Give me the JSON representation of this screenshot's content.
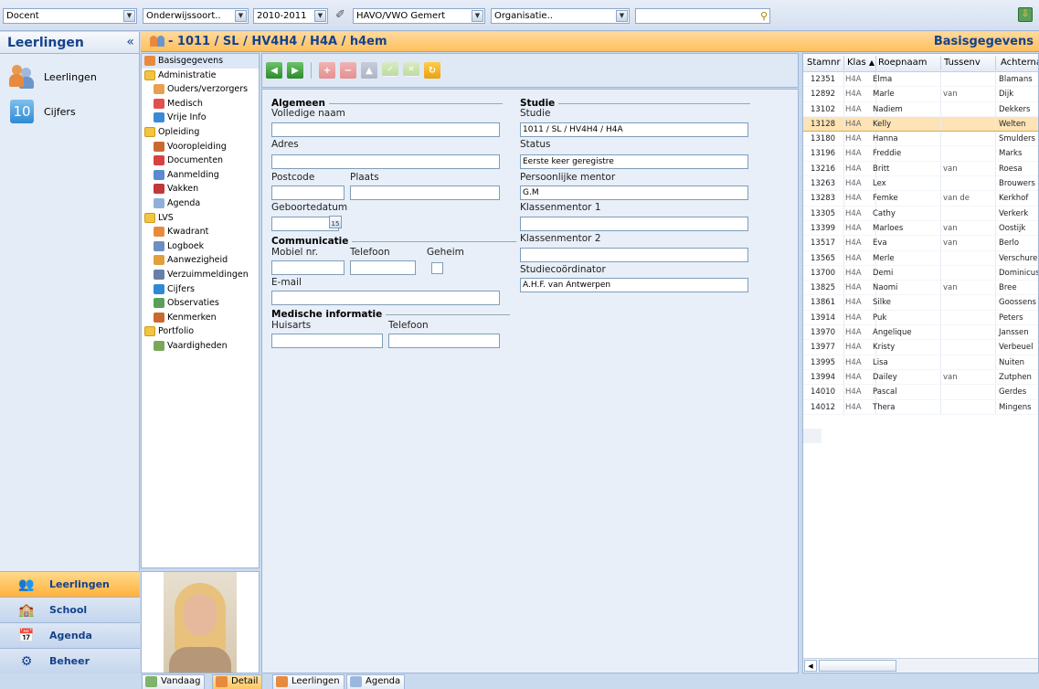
{
  "topbar": {
    "role": "Docent",
    "education_type": "Onderwijssoort..",
    "year": "2010-2011",
    "school": "HAVO/VWO Gemert",
    "organisation": "Organisatie..",
    "search_value": ""
  },
  "sidebar": {
    "title": "Leerlingen",
    "collapse_glyph": "«",
    "items": [
      {
        "label": "Leerlingen",
        "icon": "students-icon"
      },
      {
        "label": "Cijfers",
        "icon": "grades-icon",
        "badge": "10"
      }
    ],
    "sections": [
      {
        "label": "Leerlingen",
        "icon": "students-icon",
        "active": true
      },
      {
        "label": "School",
        "icon": "school-icon"
      },
      {
        "label": "Agenda",
        "icon": "calendar-icon"
      },
      {
        "label": "Beheer",
        "icon": "gear-icon"
      }
    ]
  },
  "header": {
    "title": "- 1011 / SL / HV4H4 / H4A / h4em",
    "section": "Basisgegevens"
  },
  "tree": [
    {
      "label": "Basisgegevens",
      "level": 1,
      "icon": "students-icon",
      "selected": true
    },
    {
      "label": "Administratie",
      "level": 1,
      "icon": "folder-icon"
    },
    {
      "label": "Ouders/verzorgers",
      "level": 2,
      "icon": "parents-icon"
    },
    {
      "label": "Medisch",
      "level": 2,
      "icon": "medical-icon"
    },
    {
      "label": "Vrije Info",
      "level": 2,
      "icon": "info-icon"
    },
    {
      "label": "Opleiding",
      "level": 1,
      "icon": "folder-icon"
    },
    {
      "label": "Vooropleiding",
      "level": 2,
      "icon": "education-icon"
    },
    {
      "label": "Documenten",
      "level": 2,
      "icon": "documents-icon"
    },
    {
      "label": "Aanmelding",
      "level": 2,
      "icon": "registration-icon"
    },
    {
      "label": "Vakken",
      "level": 2,
      "icon": "books-icon"
    },
    {
      "label": "Agenda",
      "level": 2,
      "icon": "calendar-icon"
    },
    {
      "label": "LVS",
      "level": 1,
      "icon": "folder-icon"
    },
    {
      "label": "Kwadrant",
      "level": 2,
      "icon": "quadrant-icon"
    },
    {
      "label": "Logboek",
      "level": 2,
      "icon": "logbook-icon"
    },
    {
      "label": "Aanwezigheid",
      "level": 2,
      "icon": "presence-icon"
    },
    {
      "label": "Verzuimmeldingen",
      "level": 2,
      "icon": "absence-icon"
    },
    {
      "label": "Cijfers",
      "level": 2,
      "icon": "grades-icon"
    },
    {
      "label": "Observaties",
      "level": 2,
      "icon": "observations-icon"
    },
    {
      "label": "Kenmerken",
      "level": 2,
      "icon": "characteristics-icon"
    },
    {
      "label": "Portfolio",
      "level": 1,
      "icon": "folder-icon"
    },
    {
      "label": "Vaardigheden",
      "level": 2,
      "icon": "skills-icon"
    }
  ],
  "form": {
    "algemeen": {
      "title": "Algemeen",
      "name_label": "Volledige naam",
      "name_value": "",
      "address_label": "Adres",
      "address_value": "",
      "postcode_label": "Postcode",
      "postcode_value": "",
      "city_label": "Plaats",
      "city_value": "",
      "birthdate_label": "Geboortedatum",
      "birthdate_value": "",
      "calendar_glyph": "15"
    },
    "communicatie": {
      "title": "Communicatie",
      "mobile_label": "Mobiel nr.",
      "phone_label": "Telefoon",
      "secret_label": "Geheim",
      "email_label": "E-mail"
    },
    "medisch": {
      "title": "Medische informatie",
      "doctor_label": "Huisarts",
      "phone_label": "Telefoon"
    },
    "studie": {
      "title": "Studie",
      "study_label": "Studie",
      "study_value": "1011 / SL / HV4H4 / H4A",
      "status_label": "Status",
      "status_value": "Eerste keer geregistre",
      "mentor_label": "Persoonlijke mentor",
      "mentor_value": "G.M",
      "class_mentor1_label": "Klassenmentor 1",
      "class_mentor1_value": "",
      "class_mentor2_label": "Klassenmentor 2",
      "class_mentor2_value": "",
      "coordinator_label": "Studiecoördinator",
      "coordinator_value": "A.H.F. van Antwerpen"
    }
  },
  "grid": {
    "columns": [
      "Stamnr",
      "Klas",
      "Roepnaam",
      "Tussenv",
      "Achterna"
    ],
    "sort_glyph": "▲",
    "rows": [
      {
        "stamnr": "12351",
        "klas": "H4A",
        "roepnaam": "Elma",
        "tussenv": "",
        "achternaam": "Blamans"
      },
      {
        "stamnr": "12892",
        "klas": "H4A",
        "roepnaam": "Marle",
        "tussenv": "van",
        "achternaam": "Dijk"
      },
      {
        "stamnr": "13102",
        "klas": "H4A",
        "roepnaam": "Nadiem",
        "tussenv": "",
        "achternaam": "Dekkers"
      },
      {
        "stamnr": "13128",
        "klas": "H4A",
        "roepnaam": "Kelly",
        "tussenv": "",
        "achternaam": "Welten",
        "highlight": true
      },
      {
        "stamnr": "13180",
        "klas": "H4A",
        "roepnaam": "Hanna",
        "tussenv": "",
        "achternaam": "Smulders"
      },
      {
        "stamnr": "13196",
        "klas": "H4A",
        "roepnaam": "Freddie",
        "tussenv": "",
        "achternaam": "Marks"
      },
      {
        "stamnr": "13216",
        "klas": "H4A",
        "roepnaam": "Britt",
        "tussenv": "van",
        "achternaam": "Roesa"
      },
      {
        "stamnr": "13263",
        "klas": "H4A",
        "roepnaam": "Lex",
        "tussenv": "",
        "achternaam": "Brouwers"
      },
      {
        "stamnr": "13283",
        "klas": "H4A",
        "roepnaam": "Femke",
        "tussenv": "van de",
        "achternaam": "Kerkhof"
      },
      {
        "stamnr": "13305",
        "klas": "H4A",
        "roepnaam": "Cathy",
        "tussenv": "",
        "achternaam": "Verkerk"
      },
      {
        "stamnr": "13399",
        "klas": "H4A",
        "roepnaam": "Marloes",
        "tussenv": "van",
        "achternaam": "Oostijk"
      },
      {
        "stamnr": "13517",
        "klas": "H4A",
        "roepnaam": "Eva",
        "tussenv": "van",
        "achternaam": "Berlo"
      },
      {
        "stamnr": "13565",
        "klas": "H4A",
        "roepnaam": "Merle",
        "tussenv": "",
        "achternaam": "Verschuren"
      },
      {
        "stamnr": "13700",
        "klas": "H4A",
        "roepnaam": "Demi",
        "tussenv": "",
        "achternaam": "Dominicus"
      },
      {
        "stamnr": "13825",
        "klas": "H4A",
        "roepnaam": "Naomi",
        "tussenv": "van",
        "achternaam": "Bree"
      },
      {
        "stamnr": "13861",
        "klas": "H4A",
        "roepnaam": "Silke",
        "tussenv": "",
        "achternaam": "Goossens"
      },
      {
        "stamnr": "13914",
        "klas": "H4A",
        "roepnaam": "Puk",
        "tussenv": "",
        "achternaam": "Peters"
      },
      {
        "stamnr": "13970",
        "klas": "H4A",
        "roepnaam": "Angelique",
        "tussenv": "",
        "achternaam": "Janssen"
      },
      {
        "stamnr": "13977",
        "klas": "H4A",
        "roepnaam": "Kristy",
        "tussenv": "",
        "achternaam": "Verbeuel"
      },
      {
        "stamnr": "13995",
        "klas": "H4A",
        "roepnaam": "Lisa",
        "tussenv": "",
        "achternaam": "Nuiten"
      },
      {
        "stamnr": "13994",
        "klas": "H4A",
        "roepnaam": "Dailey",
        "tussenv": "van",
        "achternaam": "Zutphen"
      },
      {
        "stamnr": "14010",
        "klas": "H4A",
        "roepnaam": "Pascal",
        "tussenv": "",
        "achternaam": "Gerdes"
      },
      {
        "stamnr": "14012",
        "klas": "H4A",
        "roepnaam": "Thera",
        "tussenv": "",
        "achternaam": "Mingens"
      }
    ]
  },
  "bottom_tabs": [
    {
      "label": "Vandaag",
      "active": false
    },
    {
      "label": "Detail",
      "active": true
    },
    {
      "label": "Leerlingen",
      "active": false
    },
    {
      "label": "Agenda",
      "active": false
    }
  ]
}
